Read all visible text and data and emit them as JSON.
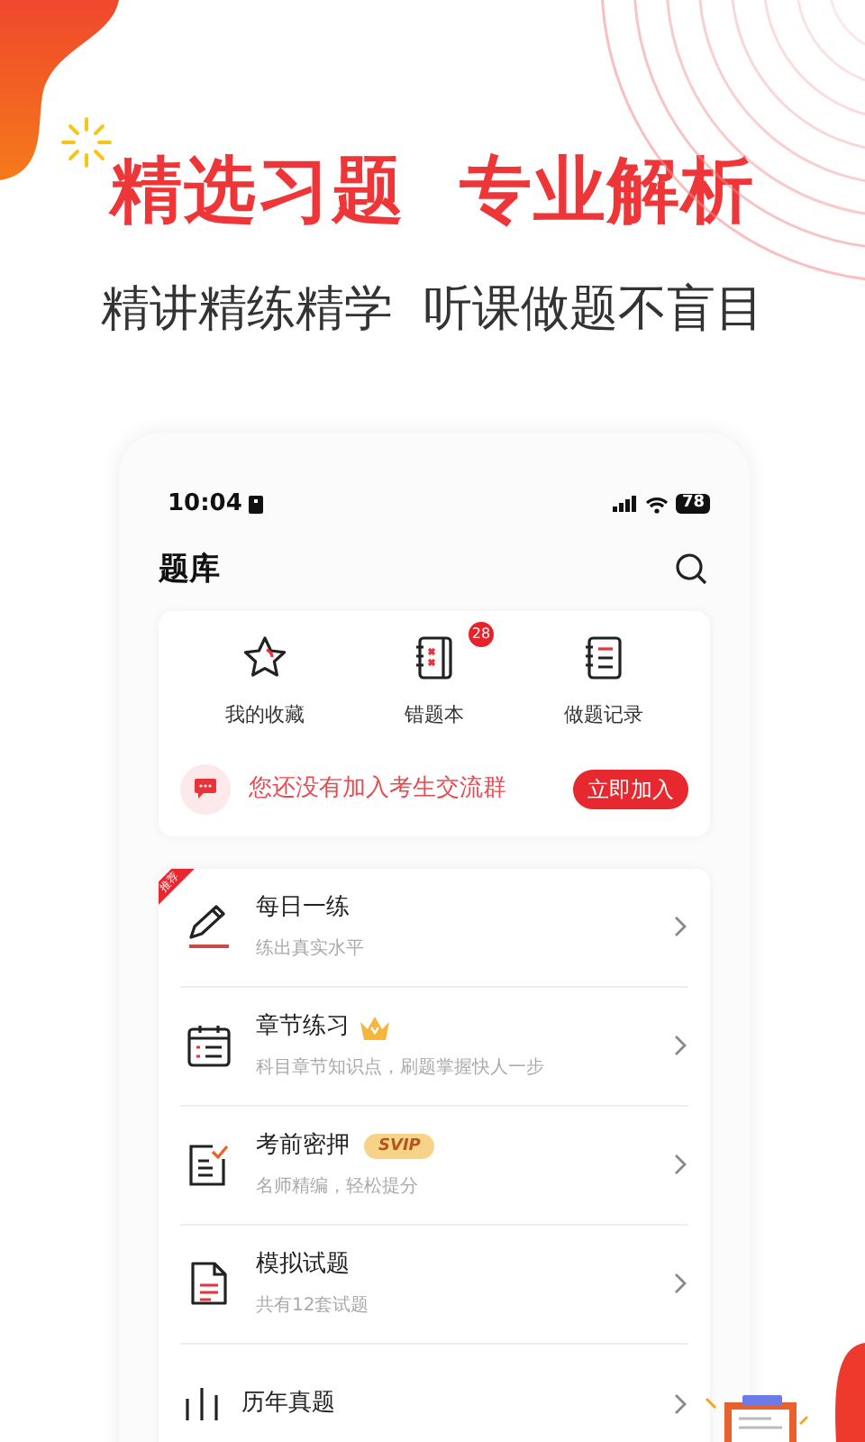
{
  "headline": "精选习题  专业解析",
  "subtitle": "精讲精练精学  听课做题不盲目",
  "status_bar": {
    "time": "10:04",
    "battery": "78"
  },
  "page_title": "题库",
  "shortcuts": [
    {
      "kind": "star",
      "label": "我的收藏"
    },
    {
      "kind": "wrongbook",
      "label": "错题本",
      "badge": "28"
    },
    {
      "kind": "record",
      "label": "做题记录"
    }
  ],
  "group_banner": {
    "text": "您还没有加入考生交流群",
    "button": "立即加入"
  },
  "practice_items": [
    {
      "kind": "pen",
      "title": "每日一练",
      "subtitle": "练出真实水平",
      "tag": "推荐"
    },
    {
      "kind": "calendar",
      "title": "章节练习",
      "subtitle": "科目章节知识点，刷题掌握快人一步",
      "crown": true
    },
    {
      "kind": "checklist",
      "title": "考前密押",
      "subtitle": "名师精编，轻松提分",
      "badge": "SVIP"
    },
    {
      "kind": "document",
      "title": "模拟试题",
      "subtitle": "共有12套试题"
    },
    {
      "kind": "chart",
      "title": "历年真题"
    }
  ]
}
